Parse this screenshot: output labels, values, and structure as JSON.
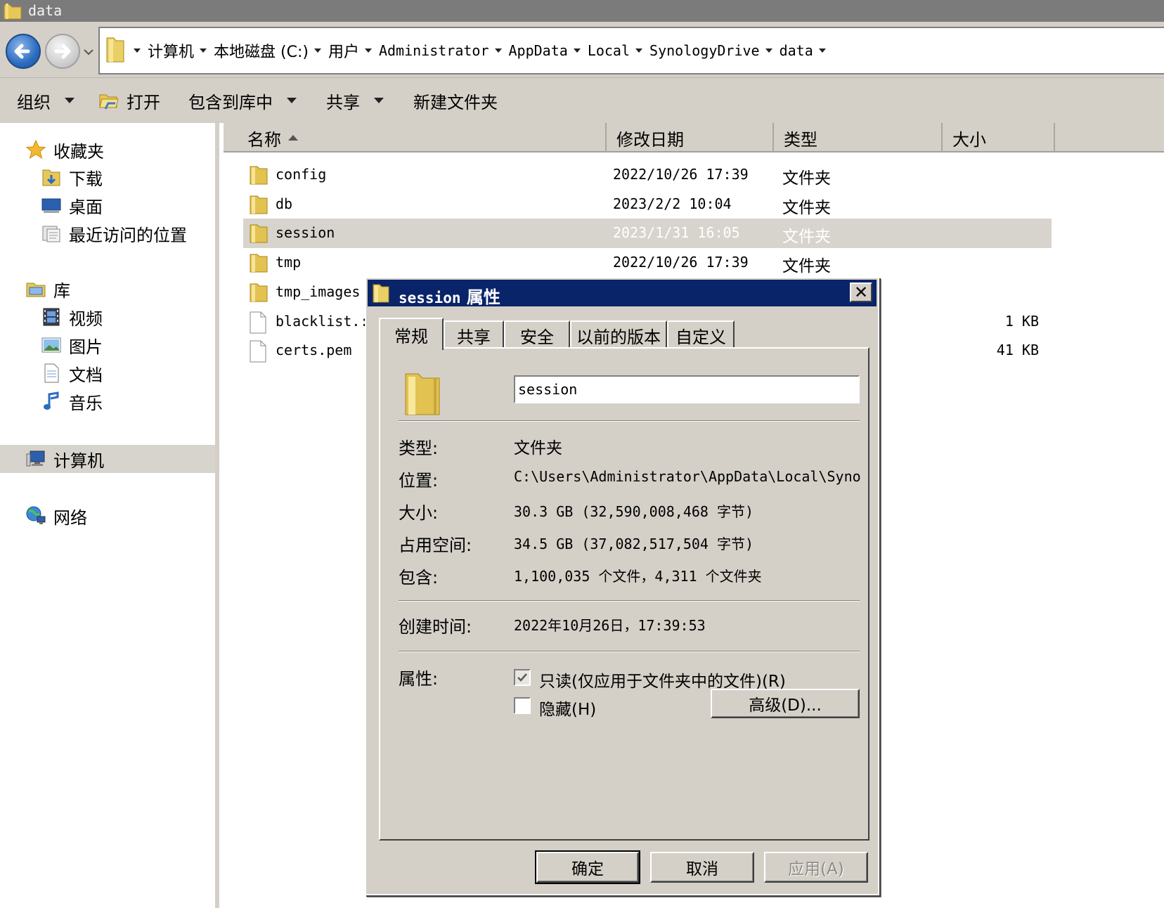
{
  "window": {
    "title": "data"
  },
  "address": {
    "crumbs": [
      {
        "label": "计算机",
        "mono": false
      },
      {
        "label": "本地磁盘 (C:)",
        "mono": false
      },
      {
        "label": "用户",
        "mono": false
      },
      {
        "label": "Administrator",
        "mono": true
      },
      {
        "label": "AppData",
        "mono": true
      },
      {
        "label": "Local",
        "mono": true
      },
      {
        "label": "SynologyDrive",
        "mono": true
      },
      {
        "label": "data",
        "mono": true
      }
    ]
  },
  "commands": {
    "organize": "组织",
    "open": "打开",
    "include_in_library": "包含到库中",
    "share": "共享",
    "new_folder": "新建文件夹"
  },
  "nav": {
    "favorites": "收藏夹",
    "downloads": "下载",
    "desktop": "桌面",
    "recent": "最近访问的位置",
    "libraries": "库",
    "videos": "视频",
    "pictures": "图片",
    "documents": "文档",
    "music": "音乐",
    "computer": "计算机",
    "network": "网络"
  },
  "columns": {
    "name": "名称",
    "date": "修改日期",
    "type": "类型",
    "size": "大小"
  },
  "files": [
    {
      "name": "config",
      "date": "2022/10/26 17:39",
      "type": "文件夹",
      "size": ""
    },
    {
      "name": "db",
      "date": "2023/2/2 10:04",
      "type": "文件夹",
      "size": ""
    },
    {
      "name": "session",
      "date": "2023/1/31 16:05",
      "type": "文件夹",
      "size": ""
    },
    {
      "name": "tmp",
      "date": "2022/10/26 17:39",
      "type": "文件夹",
      "size": ""
    },
    {
      "name": "tmp_images",
      "date": "",
      "type": "",
      "size": ""
    },
    {
      "name": "blacklist.:",
      "date": "",
      "type": "",
      "size": "1 KB"
    },
    {
      "name": "certs.pem",
      "date": "",
      "type": "",
      "size": "41 KB"
    }
  ],
  "dialog": {
    "title_name": "session",
    "title_suffix": "属性",
    "close": "✕",
    "tabs": [
      "常规",
      "共享",
      "安全",
      "以前的版本",
      "自定义"
    ],
    "name_value": "session",
    "type_label": "类型:",
    "type_value": "文件夹",
    "location_label": "位置:",
    "location_value": "C:\\Users\\Administrator\\AppData\\Local\\Synology",
    "size_label": "大小:",
    "size_value": "30.3 GB (32,590,008,468 字节)",
    "disk_label": "占用空间:",
    "disk_value": "34.5 GB (37,082,517,504 字节)",
    "contains_label": "包含:",
    "contains_value": "1,100,035 个文件，4,311 个文件夹",
    "created_label": "创建时间:",
    "created_value": "2022年10月26日，17:39:53",
    "attributes_label": "属性:",
    "readonly_label": "只读(仅应用于文件夹中的文件)(R)",
    "readonly_checked": true,
    "hidden_label": "隐藏(H)",
    "hidden_checked": false,
    "advanced_button": "高级(D)...",
    "ok_button": "确定",
    "cancel_button": "取消",
    "apply_button": "应用(A)"
  }
}
